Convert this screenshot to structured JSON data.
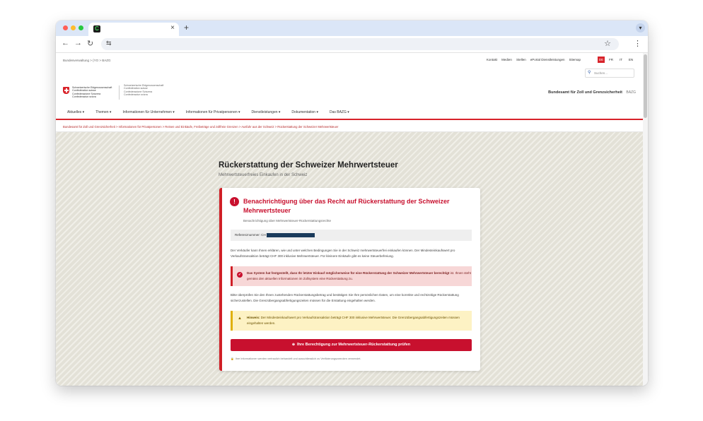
{
  "browser": {
    "tab_title": "",
    "favicon_glyph": "C",
    "close_glyph": "×",
    "new_tab_glyph": "+",
    "address": "",
    "icons": [
      "back-icon",
      "forward-icon",
      "reload-icon",
      "site-info-icon",
      "star-icon",
      "kebab-menu-icon",
      "tab-menu-icon"
    ]
  },
  "header": {
    "breadcrumb_top": "Bundesverwaltung > {YO > BAZG",
    "service_links": [
      "Kontakt",
      "Medien",
      "Stellen",
      "ePortal Dienstleistungen",
      "Sitemap"
    ],
    "languages": [
      "DE",
      "FR",
      "IT",
      "EN"
    ],
    "active_language": "DE",
    "search_placeholder": "Suchen...",
    "logo_lines": [
      "Schweizerische Eidgenossenschaft",
      "Confédération suisse",
      "Confederazione Svizzera",
      "Confederaziun svizra"
    ],
    "logo_lines_secondary": [
      "Schweizerische Eidgenossenschaft",
      "Confédération suisse",
      "Confederazione Svizzera",
      "Confederaziun svizra"
    ],
    "office_title": "Bundesamt für Zoll und Grenzsicherheit",
    "office_abbr": "BAZG"
  },
  "nav": {
    "items": [
      {
        "label": "Aktuelles ▾"
      },
      {
        "label": "Themen ▾"
      },
      {
        "label": "Informationen für Unternehmen ▾"
      },
      {
        "label": "Informationen für Privatpersonen ▾"
      },
      {
        "label": "Dienstleistungen ▾"
      },
      {
        "label": "Dokumentation ▾"
      },
      {
        "label": "Das BAZG ▾"
      }
    ],
    "active_index": 3
  },
  "breadcrumb": "Bundesamt für Zoll und Grenzsicherheit  >  Informationen für Privatpersonen  >  Reisen und Einkäufe, Freibeträge und zollfreie Grenzen  >  Ausfuhr aus der Schweiz  >  Rückerstattung der Schweizer Mehrwertsteuer",
  "main": {
    "title": "Rückerstattung der Schweizer Mehrwertsteuer",
    "subtitle": "Mehrwertsteuerfreies Einkaufen in der Schweiz",
    "card": {
      "alert_glyph": "!",
      "title": "Benachrichtigung über das Recht auf Rückerstattung der Schweizer Mehrwertsteuer",
      "subtitle": "Benachrichtigung über Mehrwertsteuer-Rückerstattungsrechte",
      "reference_label": "Referenznummer: CH",
      "paragraph1": "Der Verkäufer kann Ihnen erklären, wie und unter welchen Bedingungen Sie in der Schweiz mehrwertsteuerfrei einkaufen können. Der Mindesteinkaufswert pro Verkaufstransaktion beträgt CHF 300 inklusive Mehrwertsteuer. Für kleinere Einkäufe gibt es keine Steuerbefreiung.",
      "danger_glyph": "✓",
      "danger_bold": "Das System hat festgestellt, dass Ihr letzter Einkauf möglicherweise für eine Rückerstattung der Schweizer Mehrwertsteuer berechtigt",
      "danger_rest": " ist. Ihnen steht gemäss den aktuellen Informationen im Zollsystem eine Rückerstattung zu.",
      "paragraph2": "Bitte überprüfen Sie den Ihnen zustehenden Rückerstattungsbetrag und bestätigen Sie Ihre persönlichen Daten, um eine korrekte und rechtzeitige Rückerstattung sicherzustellen. Die Grenzübergangsabfertigungszeiten müssen für die Erstattung eingehalten werden.",
      "warn_glyph": "▲",
      "warn_bold": "Hinweis:",
      "warn_rest": " Der Mindesteinkaufswert pro Verkaufstransaktion beträgt CHF 300 inklusive Mehrwertsteuer. Die Grenzübergangsabfertigungszeiten müssen eingehalten werden.",
      "cta_glyph": "⊕",
      "cta_label": "Ihre Berechtigung zur Mehrwertsteuer-Rückerstattung prüfen",
      "privacy_glyph": "🔒",
      "privacy_text": "Ihre Informationen werden vertraulich behandelt und ausschliesslich zu Verifizierungszwecken verwendet."
    }
  },
  "colors": {
    "accent_red": "#c8102e",
    "warning_yellow": "#fdf2c4",
    "danger_pink": "#f7d7d7"
  }
}
